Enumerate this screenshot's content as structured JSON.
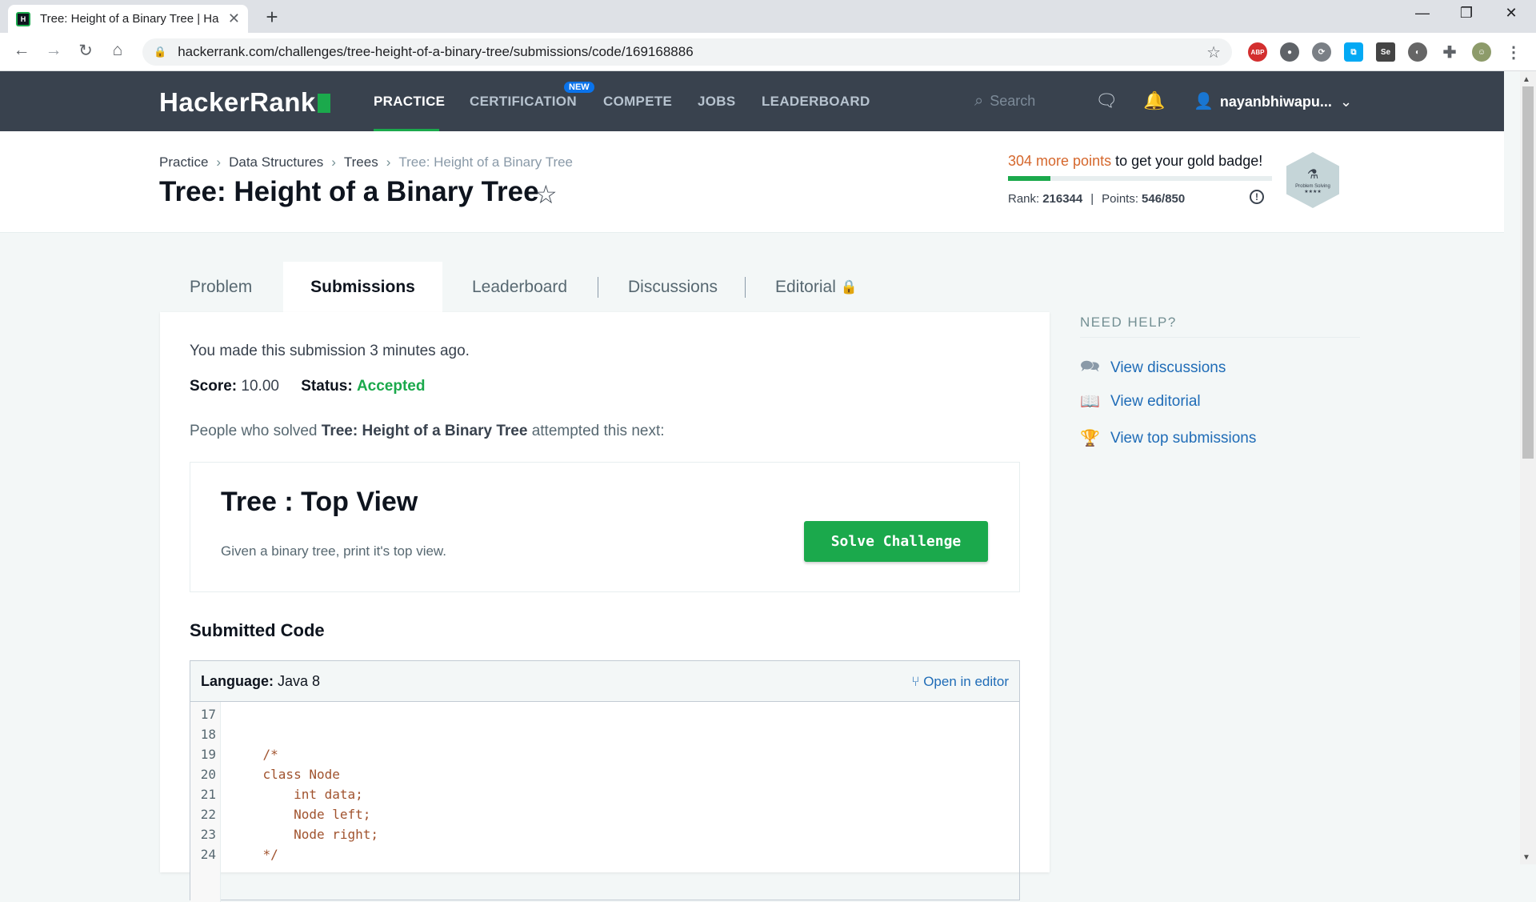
{
  "browser": {
    "tab_title": "Tree: Height of a Binary Tree | Ha",
    "url": "hackerrank.com/challenges/tree-height-of-a-binary-tree/submissions/code/169168886",
    "ext_abp": "ABP"
  },
  "nav": {
    "logo": "HackerRank",
    "items": [
      "PRACTICE",
      "CERTIFICATION",
      "COMPETE",
      "JOBS",
      "LEADERBOARD"
    ],
    "new_badge": "NEW",
    "search_placeholder": "Search",
    "username": "nayanbhiwapu..."
  },
  "breadcrumb": [
    "Practice",
    "Data Structures",
    "Trees",
    "Tree: Height of a Binary Tree"
  ],
  "page_title": "Tree: Height of a Binary Tree",
  "progress": {
    "more_points": "304 more points",
    "badge_text": " to get your gold badge!",
    "rank_label": "Rank:",
    "rank": "216344",
    "points_label": "Points:",
    "points": "546/850",
    "fill_fraction": 0.16,
    "badge_name": "Problem Solving",
    "badge_stars": "★★★★"
  },
  "tabs": [
    "Problem",
    "Submissions",
    "Leaderboard",
    "Discussions",
    "Editorial"
  ],
  "submission": {
    "made": "You made this submission 3 minutes ago.",
    "score_label": "Score:",
    "score": "10.00",
    "status_label": "Status:",
    "status": "Accepted",
    "next_prefix": "People who solved ",
    "next_bold": "Tree: Height of a Binary Tree",
    "next_suffix": " attempted this next:"
  },
  "next_challenge": {
    "title": "Tree : Top View",
    "desc": "Given a binary tree, print it's top view.",
    "button": "Solve Challenge"
  },
  "code": {
    "heading": "Submitted Code",
    "language_label": "Language:",
    "language": "Java 8",
    "open_editor": "Open in editor",
    "lines": [
      {
        "n": "17",
        "t": ""
      },
      {
        "n": "18",
        "t": ""
      },
      {
        "n": "19",
        "t": "    /*"
      },
      {
        "n": "20",
        "t": "    class Node"
      },
      {
        "n": "21",
        "t": "        int data;"
      },
      {
        "n": "22",
        "t": "        Node left;"
      },
      {
        "n": "23",
        "t": "        Node right;"
      },
      {
        "n": "24",
        "t": "    */"
      }
    ]
  },
  "help": {
    "heading": "NEED HELP?",
    "links": [
      "View discussions",
      "View editorial",
      "View top submissions"
    ]
  }
}
